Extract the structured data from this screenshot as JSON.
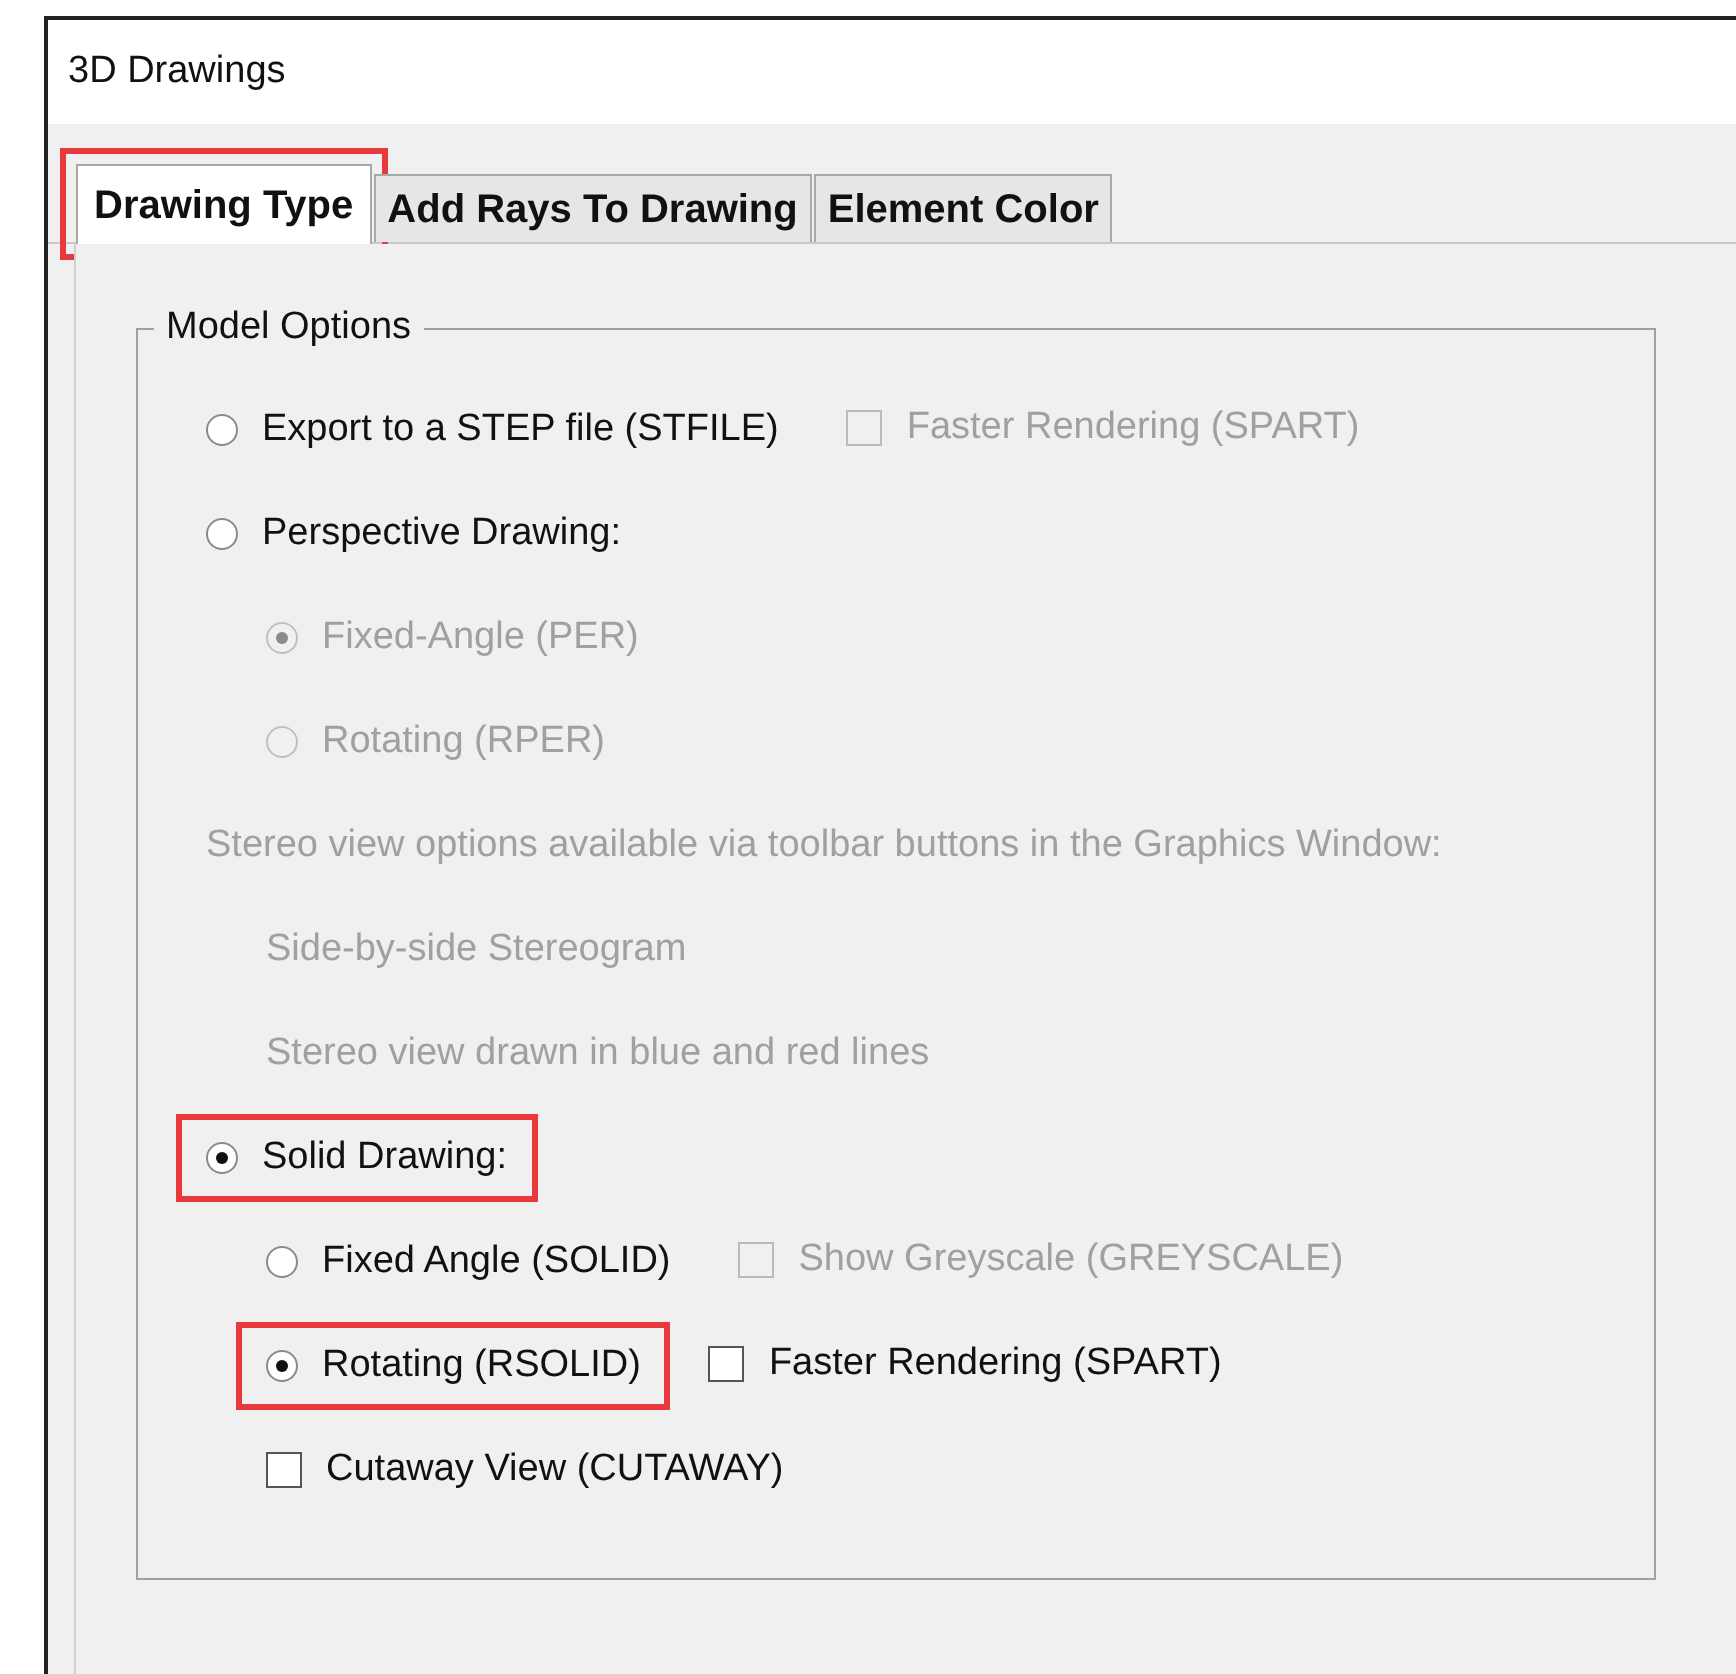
{
  "window": {
    "title": "3D Drawings"
  },
  "tabs": [
    {
      "label": "Drawing Type",
      "selected": true,
      "highlighted": true
    },
    {
      "label": "Add Rays To Drawing",
      "selected": false,
      "highlighted": false
    },
    {
      "label": "Element Color",
      "selected": false,
      "highlighted": false
    }
  ],
  "group": {
    "title": "Model Options",
    "options": [
      {
        "kind": "radio",
        "label": "Export to a STEP file (STFILE)",
        "selected": false,
        "disabled": false,
        "highlighted": false,
        "side": {
          "kind": "checkbox",
          "label": "Faster Rendering (SPART)",
          "checked": false,
          "disabled": true
        }
      },
      {
        "kind": "radio",
        "label": "Perspective Drawing:",
        "selected": false,
        "disabled": false,
        "highlighted": false,
        "children": [
          {
            "kind": "radio",
            "label": "Fixed-Angle (PER)",
            "selected": true,
            "disabled": true,
            "highlighted": false
          },
          {
            "kind": "radio",
            "label": "Rotating (RPER)",
            "selected": false,
            "disabled": true,
            "highlighted": false
          }
        ]
      },
      {
        "kind": "note",
        "label": "Stereo view options available via toolbar buttons in the Graphics Window:",
        "disabled": true,
        "children": [
          {
            "kind": "note",
            "label": "Side-by-side Stereogram",
            "disabled": true
          },
          {
            "kind": "note",
            "label": "Stereo view drawn in blue and red lines",
            "disabled": true
          }
        ]
      },
      {
        "kind": "radio",
        "label": "Solid Drawing:",
        "selected": true,
        "disabled": false,
        "highlighted": true,
        "children": [
          {
            "kind": "radio",
            "label": "Fixed Angle (SOLID)",
            "selected": false,
            "disabled": false,
            "highlighted": false,
            "side": {
              "kind": "checkbox",
              "label": "Show Greyscale (GREYSCALE)",
              "checked": false,
              "disabled": true
            }
          },
          {
            "kind": "radio",
            "label": "Rotating (RSOLID)",
            "selected": true,
            "disabled": false,
            "highlighted": true,
            "side": {
              "kind": "checkbox",
              "label": "Faster Rendering (SPART)",
              "checked": false,
              "disabled": false
            }
          },
          {
            "kind": "checkbox",
            "label": "Cutaway View (CUTAWAY)",
            "checked": false,
            "disabled": false
          }
        ]
      }
    ]
  }
}
